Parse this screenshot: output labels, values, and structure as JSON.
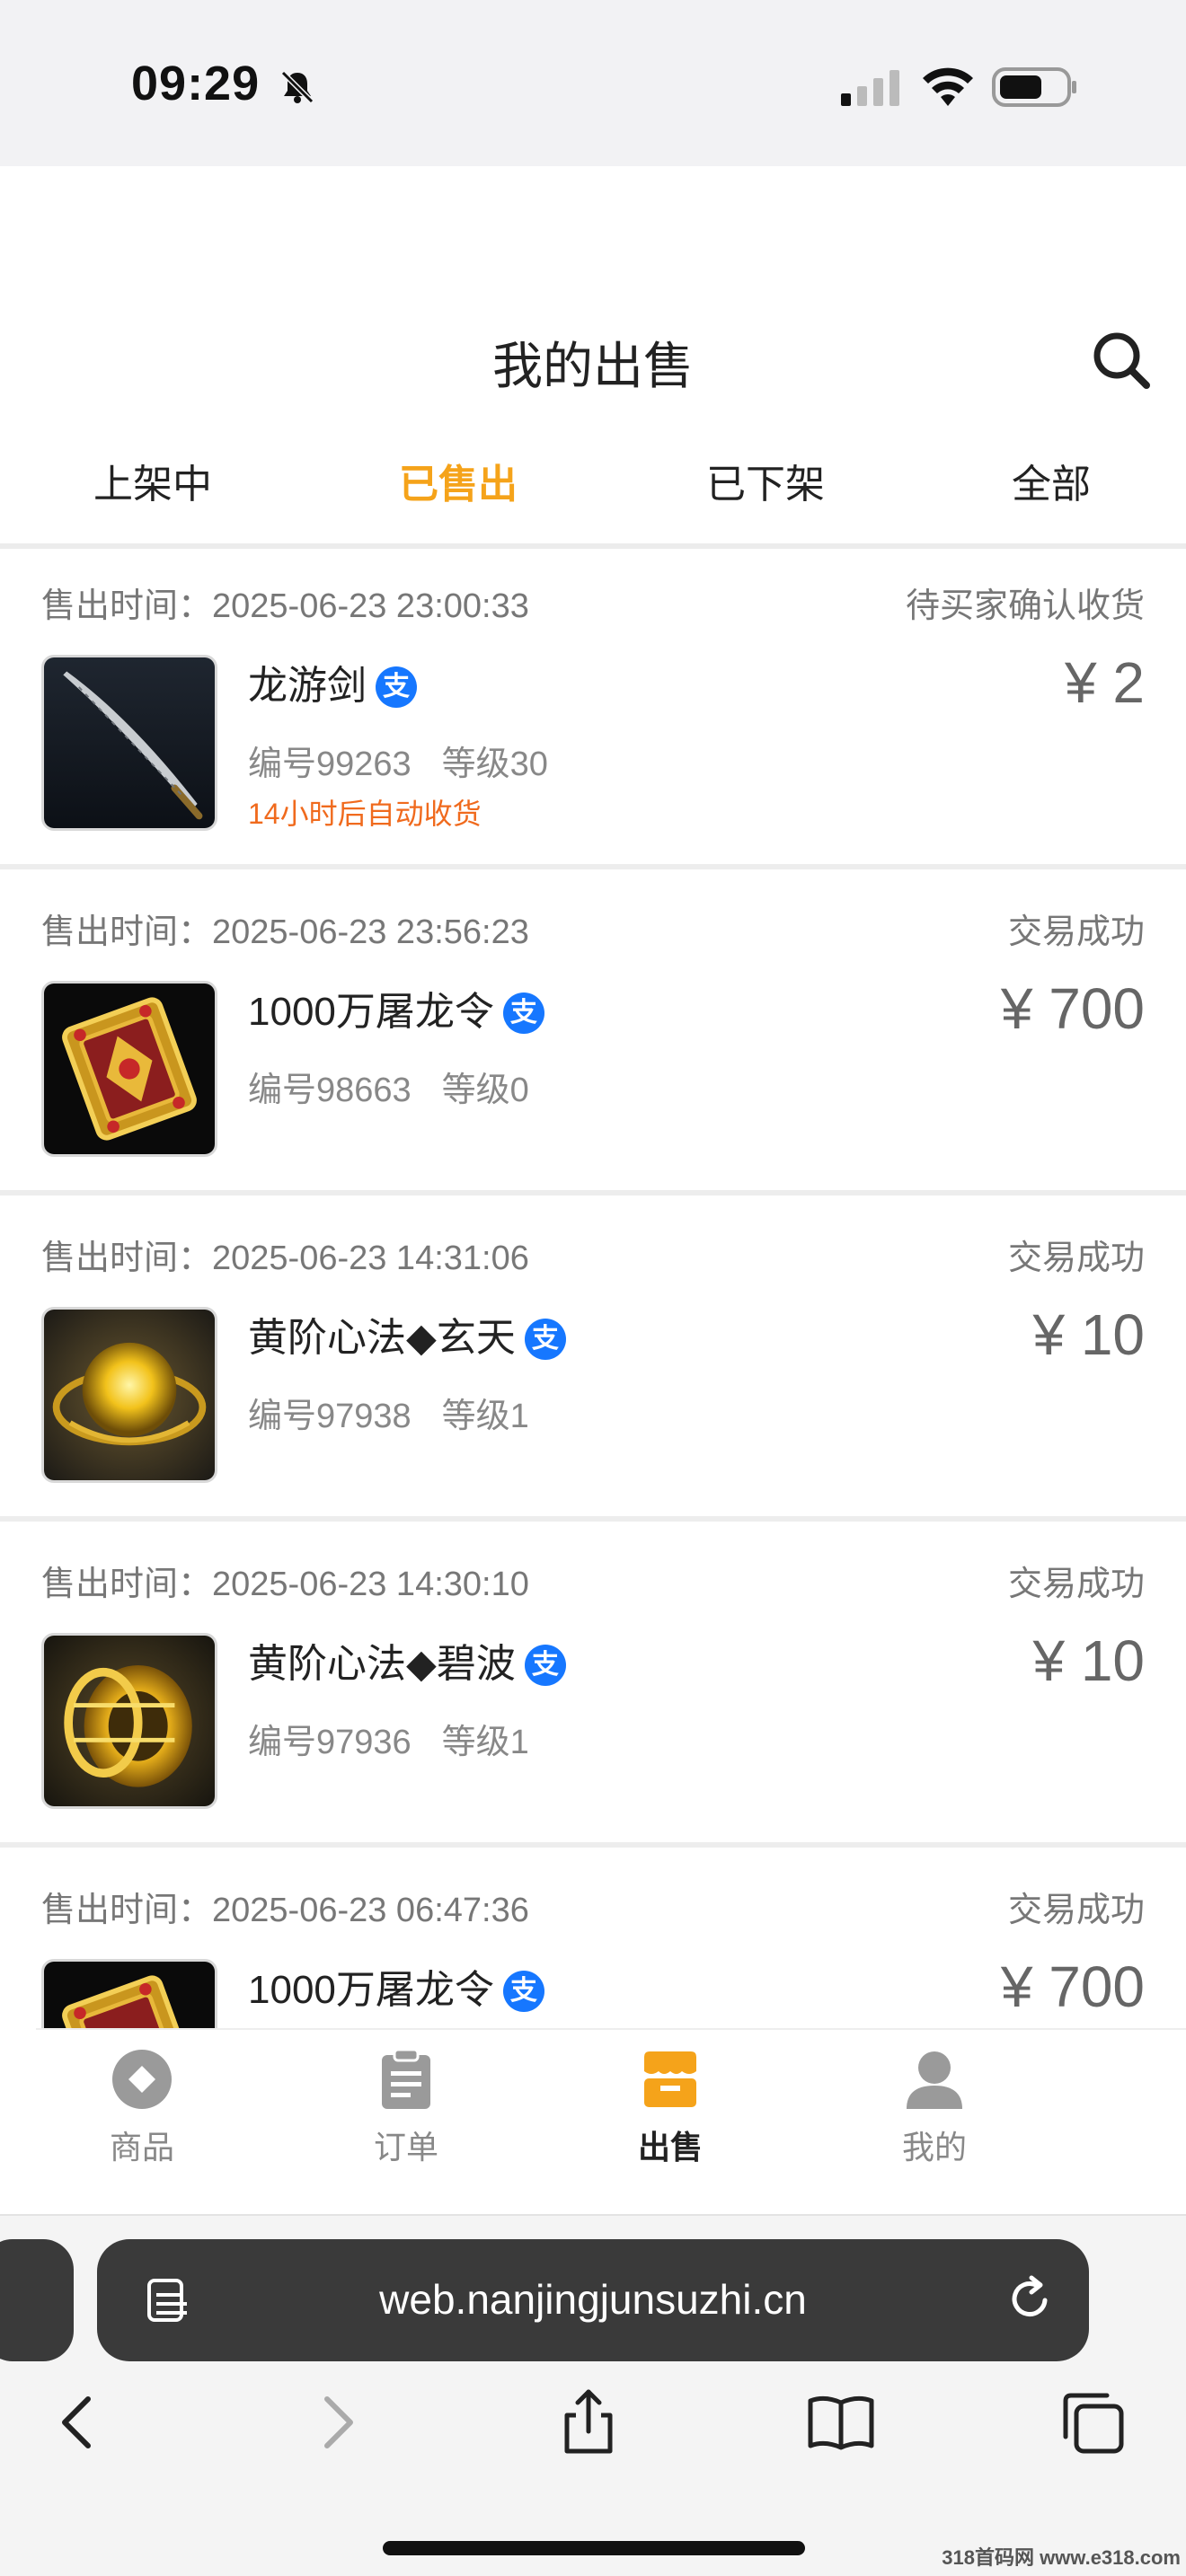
{
  "status_bar": {
    "time": "09:29"
  },
  "header": {
    "title": "我的出售"
  },
  "tabs": [
    {
      "label": "上架中",
      "active": false
    },
    {
      "label": "已售出",
      "active": true
    },
    {
      "label": "已下架",
      "active": false
    },
    {
      "label": "全部",
      "active": false
    }
  ],
  "orders": [
    {
      "time_label": "售出时间：2025-06-23 23:00:33",
      "status": "待买家确认收货",
      "name": "龙游剑",
      "pay_icon": "支",
      "code": "编号99263",
      "level": "等级30",
      "note": "14小时后自动收货",
      "price": "¥ 2",
      "thumb": "sword"
    },
    {
      "time_label": "售出时间：2025-06-23 23:56:23",
      "status": "交易成功",
      "name": "1000万屠龙令",
      "pay_icon": "支",
      "code": "编号98663",
      "level": "等级0",
      "note": "",
      "price": "¥ 700",
      "thumb": "token"
    },
    {
      "time_label": "售出时间：2025-06-23 14:31:06",
      "status": "交易成功",
      "name": "黄阶心法◆玄天",
      "pay_icon": "支",
      "code": "编号97938",
      "level": "等级1",
      "note": "",
      "price": "¥ 10",
      "thumb": "orb"
    },
    {
      "time_label": "售出时间：2025-06-23 14:30:10",
      "status": "交易成功",
      "name": "黄阶心法◆碧波",
      "pay_icon": "支",
      "code": "编号97936",
      "level": "等级1",
      "note": "",
      "price": "¥ 10",
      "thumb": "ring"
    },
    {
      "time_label": "售出时间：2025-06-23 06:47:36",
      "status": "交易成功",
      "name": "1000万屠龙令",
      "pay_icon": "支",
      "code": "",
      "level": "",
      "note": "",
      "price": "¥ 700",
      "thumb": "token"
    }
  ],
  "bottom_nav": [
    {
      "label": "商品",
      "icon": "diamond-icon",
      "active": false
    },
    {
      "label": "订单",
      "icon": "clipboard-icon",
      "active": false
    },
    {
      "label": "出售",
      "icon": "store-icon",
      "active": true
    },
    {
      "label": "我的",
      "icon": "person-icon",
      "active": false
    }
  ],
  "browser": {
    "url": "web.nanjingjunsuzhi.cn"
  },
  "watermark": "318首码网 www.e318.com",
  "colors": {
    "accent": "#f5a31a",
    "pay_blue": "#1677ff",
    "note_orange": "#f06a1d"
  }
}
